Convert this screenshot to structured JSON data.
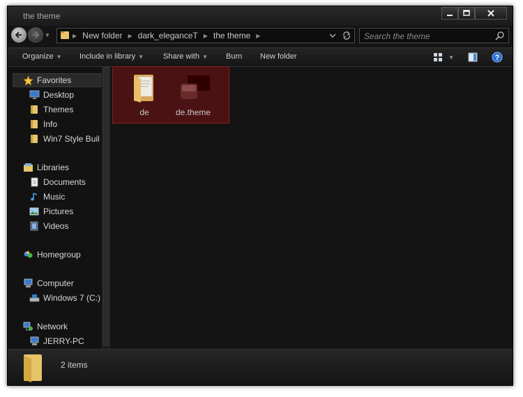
{
  "window": {
    "title": "the theme"
  },
  "address": {
    "crumbs": [
      {
        "label": "New folder"
      },
      {
        "label": "dark_eleganceT"
      },
      {
        "label": "the theme"
      }
    ]
  },
  "search": {
    "placeholder": "Search the theme"
  },
  "toolbar": {
    "organize": "Organize",
    "include_in_library": "Include in library",
    "share_with": "Share with",
    "burn": "Burn",
    "new_folder": "New folder"
  },
  "sidebar": {
    "favorites": {
      "label": "Favorites",
      "items": [
        "Desktop",
        "Themes",
        "Info",
        "Win7 Style Buil"
      ]
    },
    "libraries": {
      "label": "Libraries",
      "items": [
        "Documents",
        "Music",
        "Pictures",
        "Videos"
      ]
    },
    "homegroup": {
      "label": "Homegroup"
    },
    "computer": {
      "label": "Computer",
      "items": [
        "Windows 7 (C:)"
      ]
    },
    "network": {
      "label": "Network",
      "items": [
        "JERRY-PC"
      ]
    }
  },
  "files": [
    {
      "name": "de",
      "icon": "folder-icon"
    },
    {
      "name": "de.theme",
      "icon": "theme-file-icon"
    }
  ],
  "status": {
    "item_count": "2 items"
  },
  "colors": {
    "selection_fill": "#4a1212",
    "selection_border": "#8a2020",
    "background": "#141414"
  }
}
